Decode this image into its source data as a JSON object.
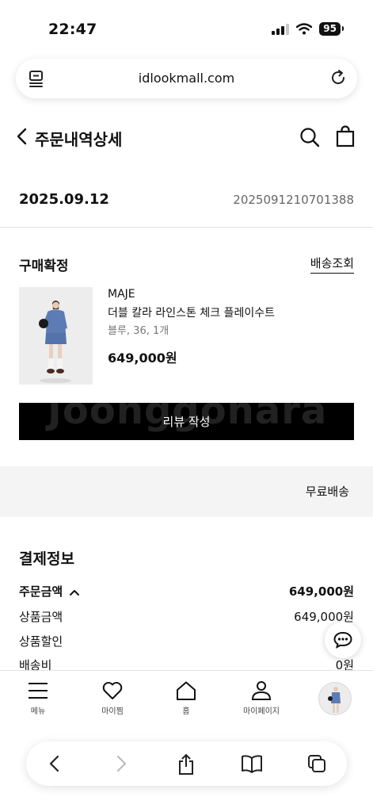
{
  "status_bar": {
    "time": "22:47",
    "battery": "95"
  },
  "browser": {
    "url": "idlookmall.com"
  },
  "header": {
    "title": "주문내역상세"
  },
  "order": {
    "date": "2025.09.12",
    "number": "2025091210701388",
    "status": "구매확정",
    "tracking_link": "배송조회"
  },
  "product": {
    "brand": "MAJE",
    "name": "더블 칼라 라인스톤 체크 플레이수트",
    "option": "블루, 36, 1개",
    "price": "649,000원"
  },
  "review_button": {
    "label": "리뷰 작성",
    "watermark": "Joonggonara"
  },
  "shipping": {
    "fee_label": "무료배송"
  },
  "payment": {
    "title": "결제정보",
    "rows": [
      {
        "label": "주문금액",
        "value": "649,000원"
      },
      {
        "label": "상품금액",
        "value": "649,000원"
      },
      {
        "label": "상품할인",
        "value": ""
      },
      {
        "label": "배송비",
        "value": "0원"
      }
    ]
  },
  "tabbar": {
    "items": [
      {
        "label": "메뉴",
        "icon": "hamburger-menu-icon"
      },
      {
        "label": "마이찜",
        "icon": "heart-icon"
      },
      {
        "label": "홈",
        "icon": "home-icon"
      },
      {
        "label": "마이페이지",
        "icon": "person-icon"
      }
    ]
  },
  "icons": {
    "reader": "reader-icon",
    "reload": "reload-icon",
    "back": "chevron-left-icon",
    "search": "search-icon",
    "bag": "shopping-bag-icon",
    "chat": "chat-bubble-icon"
  }
}
